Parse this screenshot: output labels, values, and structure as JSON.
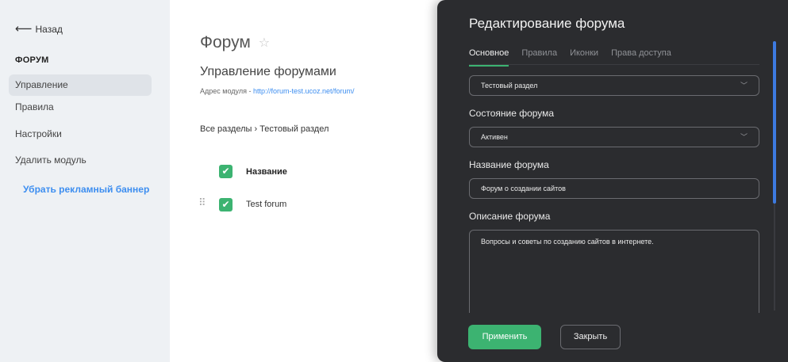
{
  "sidebar": {
    "back_label": "Назад",
    "section_title": "ФОРУМ",
    "items": [
      {
        "label": "Управление",
        "active": true
      },
      {
        "label": "Правила",
        "active": false
      },
      {
        "label": "Настройки",
        "active": false
      },
      {
        "label": "Удалить модуль",
        "active": false
      }
    ],
    "promo_link": "Убрать рекламный баннер"
  },
  "main": {
    "title": "Форум",
    "subtitle": "Управление форумами",
    "address_label": "Адрес модуля - ",
    "address_url": "http://forum-test.ucoz.net/forum/",
    "breadcrumb": "Все разделы › Тестовый раздел",
    "table": {
      "column_name": "Название",
      "rows": [
        {
          "name": "Test forum"
        }
      ]
    }
  },
  "panel": {
    "title": "Редактирование форума",
    "tabs": [
      {
        "label": "Основное",
        "active": true
      },
      {
        "label": "Правила",
        "active": false
      },
      {
        "label": "Иконки",
        "active": false
      },
      {
        "label": "Права доступа",
        "active": false
      }
    ],
    "section_select": {
      "value": "Тестовый раздел"
    },
    "state": {
      "label": "Состояние форума",
      "value": "Активен"
    },
    "name": {
      "label": "Название форума",
      "value": "Форум о создании сайтов"
    },
    "description": {
      "label": "Описание форума",
      "value": "Вопросы и советы по созданию сайтов в интернете."
    },
    "apply_label": "Применить",
    "close_label": "Закрыть"
  },
  "icons": {
    "back": "arrow-left-icon",
    "star": "star-icon",
    "check": "checkmark-icon",
    "drag": "drag-handle-icon",
    "chevron": "chevron-down-icon"
  },
  "colors": {
    "accent_green": "#3cb371",
    "link_blue": "#3d8ef0",
    "panel_bg": "#2b2c2f",
    "sidebar_bg": "#eef1f4"
  }
}
